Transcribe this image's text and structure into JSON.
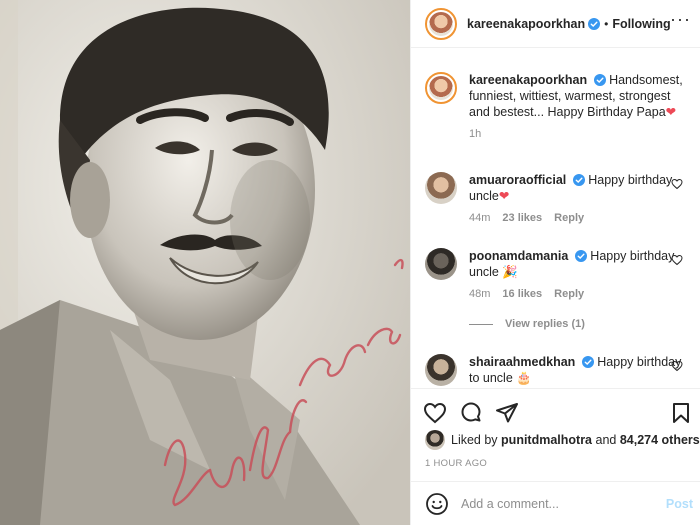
{
  "post": {
    "username": "kareenakapoorkhan",
    "follow_status": "Following",
    "dot": "•",
    "more_label": "···",
    "photo_signature": "Randhir Kapoor"
  },
  "caption": {
    "username": "kareenakapoorkhan",
    "text": "Handsomest, funniest, wittiest, warmest, strongest and bestest... Happy Birthday Papa",
    "emoji": "❤",
    "time": "1h"
  },
  "comments": [
    {
      "username": "amuaroraofficial",
      "text": "Happy birthday uncle",
      "emoji": "❤",
      "time": "44m",
      "likes": "23 likes",
      "reply": "Reply"
    },
    {
      "username": "poonamdamania",
      "text": "Happy birthday uncle",
      "emoji": "🎉",
      "time": "48m",
      "likes": "16 likes",
      "reply": "Reply",
      "view_replies": "View replies (1)"
    },
    {
      "username": "shairaahmedkhan",
      "text": "Happy birthday to uncle",
      "emoji": "🎂"
    }
  ],
  "likes": {
    "prefix": "Liked by",
    "user": "punitdmalhotra",
    "and": "and",
    "others": "84,274 others"
  },
  "timestamp": "1 HOUR AGO",
  "add_comment": {
    "placeholder": "Add a comment...",
    "post_label": "Post"
  },
  "icons": [
    "verified-icon",
    "heart-icon",
    "comment-icon",
    "share-icon",
    "bookmark-icon",
    "emoji-icon",
    "more-icon"
  ],
  "colors": {
    "verified": "#3897f0",
    "link_muted": "#8e8e8e",
    "post_disabled": "#b2dffc",
    "heart_red": "#ed4956"
  }
}
